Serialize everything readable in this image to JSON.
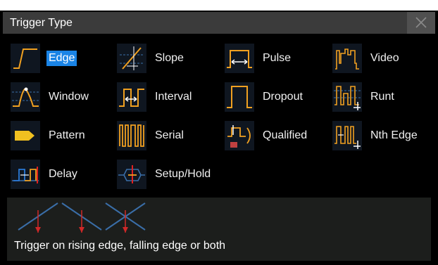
{
  "dialog": {
    "title": "Trigger Type",
    "close_icon": "close-icon"
  },
  "trigger_types": [
    {
      "label": "Edge",
      "icon": "edge-icon",
      "selected": true
    },
    {
      "label": "Slope",
      "icon": "slope-icon",
      "selected": false
    },
    {
      "label": "Pulse",
      "icon": "pulse-icon",
      "selected": false
    },
    {
      "label": "Video",
      "icon": "video-icon",
      "selected": false
    },
    {
      "label": "Window",
      "icon": "window-icon",
      "selected": false
    },
    {
      "label": "Interval",
      "icon": "interval-icon",
      "selected": false
    },
    {
      "label": "Dropout",
      "icon": "dropout-icon",
      "selected": false
    },
    {
      "label": "Runt",
      "icon": "runt-icon",
      "selected": false
    },
    {
      "label": "Pattern",
      "icon": "pattern-icon",
      "selected": false
    },
    {
      "label": "Serial",
      "icon": "serial-icon",
      "selected": false
    },
    {
      "label": "Qualified",
      "icon": "qualified-icon",
      "selected": false
    },
    {
      "label": "Nth Edge",
      "icon": "nth-edge-icon",
      "selected": false
    },
    {
      "label": "Delay",
      "icon": "delay-icon",
      "selected": false
    },
    {
      "label": "Setup/Hold",
      "icon": "setup-hold-icon",
      "selected": false
    }
  ],
  "info": {
    "description": "Trigger on rising edge, falling edge or both",
    "illustration_icons": [
      "rising-edge-icon",
      "falling-edge-icon",
      "both-edges-icon"
    ]
  },
  "colors": {
    "accent": "#1a84e6",
    "waveform": "#f0a020",
    "trigger_marker": "#e02020",
    "illustration_line": "#3a6ea8"
  }
}
